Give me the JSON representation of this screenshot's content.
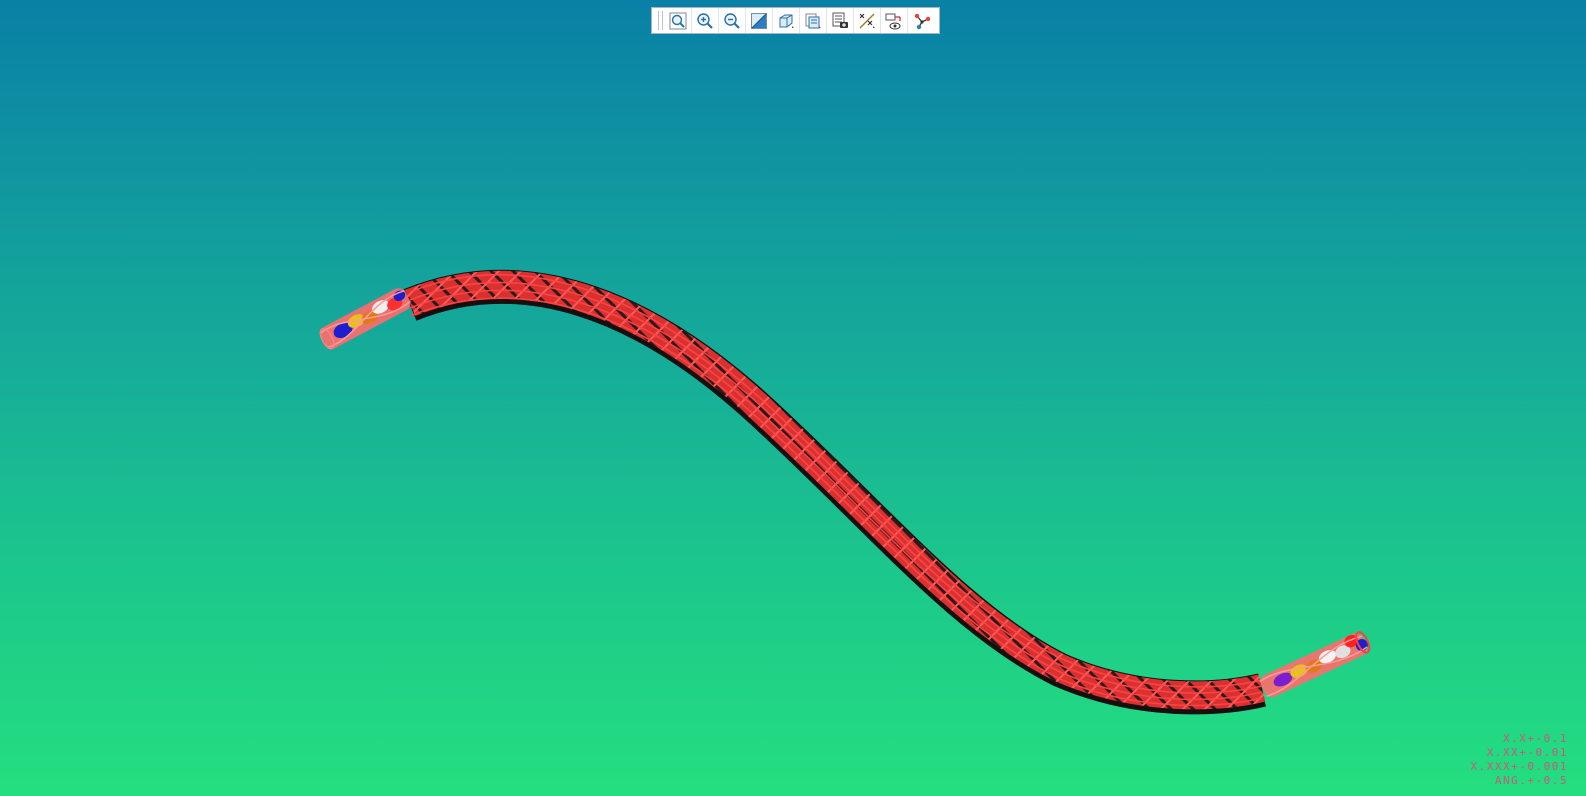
{
  "toolbar": {
    "buttons": [
      {
        "name": "refit-button",
        "icon": "refit-icon",
        "title": "Refit"
      },
      {
        "name": "zoom-in-button",
        "icon": "zoom-in-icon",
        "title": "Zoom In"
      },
      {
        "name": "zoom-out-button",
        "icon": "zoom-out-icon",
        "title": "Zoom Out"
      },
      {
        "name": "repaint-button",
        "icon": "repaint-icon",
        "title": "Repaint"
      },
      {
        "name": "display-style-button",
        "icon": "display-style-icon",
        "title": "Display Style"
      },
      {
        "name": "saved-orientations-button",
        "icon": "saved-orientations-icon",
        "title": "Saved Orientations"
      },
      {
        "name": "view-manager-button",
        "icon": "view-manager-icon",
        "title": "View Manager"
      },
      {
        "name": "datum-display-button",
        "icon": "datum-display-icon",
        "title": "Datum Display Filters"
      },
      {
        "name": "annotation-display-button",
        "icon": "annotation-display-icon",
        "title": "Annotation Display"
      },
      {
        "name": "harness-network-button",
        "icon": "network-icon",
        "title": "Network"
      }
    ]
  },
  "tolerances": {
    "line1": "X.X+-0.1",
    "line2": "X.XX+-0.01",
    "line3": "X.XXX+-0.001",
    "line4": "ANG.+-0.5"
  },
  "colors": {
    "background_top": "#0980a6",
    "background_bottom": "#24df7f",
    "braid_red": "#ff3b3b",
    "braid_dark": "#1a1414",
    "tolerance_text": "#e6417a"
  }
}
